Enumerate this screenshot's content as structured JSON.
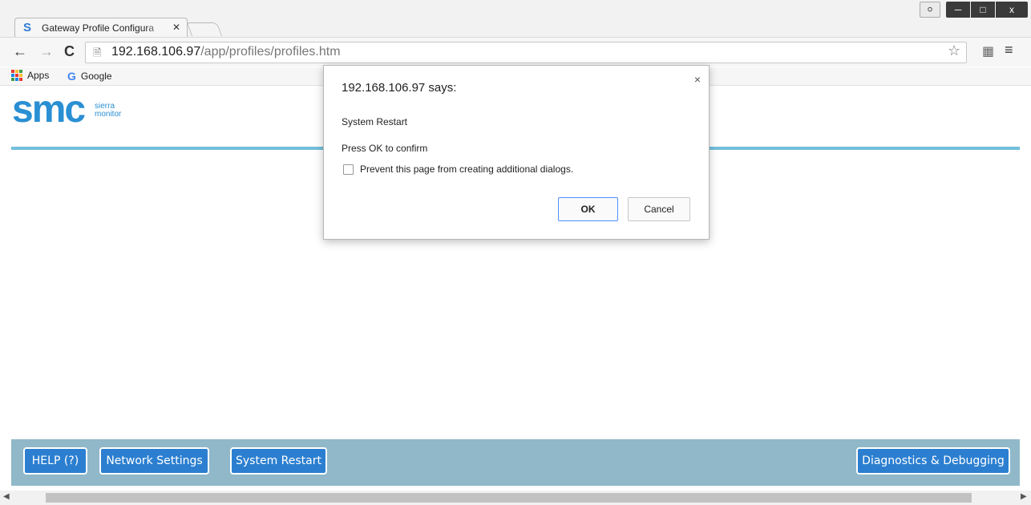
{
  "browser": {
    "tab_title": "Gateway Profile Configura",
    "tab_close": "✕",
    "url_host": "192.168.106.97",
    "url_path": "/app/profiles/profiles.htm",
    "bookmarks": [
      {
        "label": "Apps",
        "icon": "apps-grid-icon"
      },
      {
        "label": "Google",
        "icon": "google-icon"
      }
    ]
  },
  "logo": {
    "main": "smc",
    "sub_line1": "sierra",
    "sub_line2": "monitor"
  },
  "dialog": {
    "title": "192.168.106.97 says:",
    "close": "×",
    "message": "System Restart",
    "confirm_text": "Press OK to confirm",
    "checkbox_label": "Prevent this page from creating additional dialogs.",
    "ok_label": "OK",
    "cancel_label": "Cancel"
  },
  "footer": {
    "help_label": "HELP (?)",
    "network_label": "Network Settings",
    "restart_label": "System Restart",
    "diagnostics_label": "Diagnostics & Debugging"
  },
  "colors": {
    "accent_blue": "#2c7fd0",
    "footer_bar": "#90b8c8",
    "rule": "#72bfdb",
    "logo": "#2a8fd3"
  }
}
